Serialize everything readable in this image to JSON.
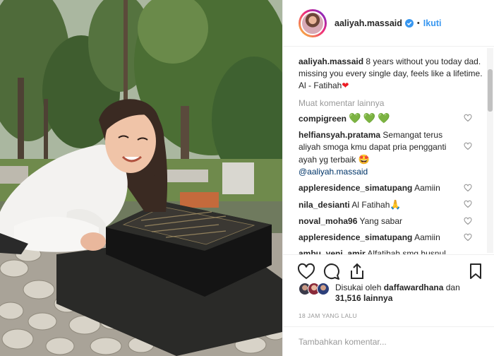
{
  "post": {
    "username": "aaliyah.massaid",
    "verified_icon": "verified-badge-icon",
    "separator": "•",
    "follow_label": "Ikuti"
  },
  "caption": {
    "username": "aaliyah.massaid",
    "text": "8 years without you today dad. missing you every single day, feels like a lifetime. Al - Fatihah",
    "emoji": "❤"
  },
  "more_comments_label": "Muat komentar lainnya",
  "comments": [
    {
      "username": "compigreen",
      "text": "",
      "emoji": "💚💚💚"
    },
    {
      "username": "helfiansyah.pratama",
      "text": "Semangat terus aliyah smoga kmu dapat pria pengganti ayah yg terbaik",
      "emoji": "🤩",
      "mention": "@aaliyah.massaid"
    },
    {
      "username": "appleresidence_simatupang",
      "text": "Aamiin"
    },
    {
      "username": "nila_desianti",
      "text": "Al Fatihah",
      "emoji": "🙏"
    },
    {
      "username": "noval_moha96",
      "text": "Yang sabar"
    },
    {
      "username": "appleresidence_simatupang",
      "text": "Aamiin"
    },
    {
      "username": "ambu_yeni_amir",
      "text": "Alfatihah smg husnul khotimah om aji masaid"
    }
  ],
  "likes": {
    "prefix": "Disukai oleh",
    "user": "daffawardhana",
    "joiner": "dan",
    "count": "31,516",
    "suffix": "lainnya"
  },
  "timestamp": "18 JAM YANG LALU",
  "add_comment": {
    "placeholder": "Tambahkan komentar..."
  },
  "colors": {
    "link": "#3897f0",
    "muted": "#999999",
    "text": "#262626",
    "border": "#efefef"
  }
}
